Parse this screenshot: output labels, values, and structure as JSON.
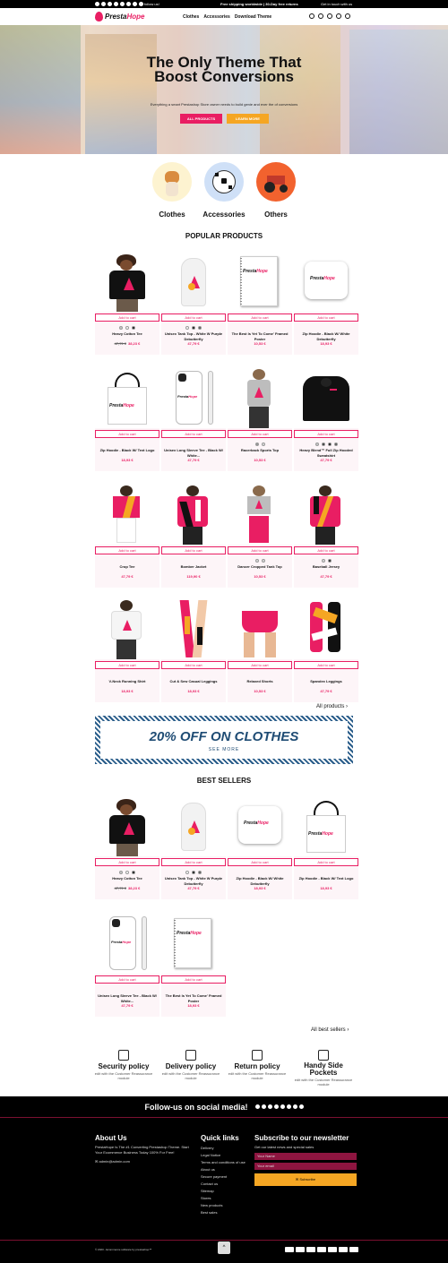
{
  "topbar": {
    "follow_label": "follow us!",
    "shipping": "Free shipping worldwide | 30-Day free returns",
    "touch": "Get in touch with us"
  },
  "header": {
    "logo_a": "Presta",
    "logo_b": "Hope",
    "nav": [
      "Clothes",
      "Accessories",
      "Download Theme"
    ]
  },
  "hero": {
    "title": "The Only Theme That Boost Conversions",
    "subtitle": "Everything a smart Prestashop Store owner needs to build genie and ever the of conversions",
    "btn_primary": "ALL PRODUCTS",
    "btn_secondary": "LEARN MORE"
  },
  "categories": [
    {
      "label": "Clothes",
      "icon": "dog-icon",
      "bg": "#fdf3d0"
    },
    {
      "label": "Accessories",
      "icon": "soccer-ball-icon",
      "bg": "#cfe0f7"
    },
    {
      "label": "Others",
      "icon": "tractor-icon",
      "bg": "#f2622e"
    }
  ],
  "popular": {
    "title": "POPULAR PRODUCTS",
    "add_to_cart": "Add to cart",
    "products": [
      {
        "name": "Heavy Cotton Tee",
        "price": "38,23 €",
        "old_price": "47,79 €",
        "img": "tshirt-woman"
      },
      {
        "name": "Unisex Tank Top - White W Purple Debutterfly",
        "price": "47,79 €",
        "img": "tank-white"
      },
      {
        "name": "The Best Is Yet To Come' Framed Poster",
        "price": "10,53 €",
        "img": "notebook"
      },
      {
        "name": "Zip Hoodie - Black W/ White Debutterfly",
        "price": "18,93 €",
        "img": "pillow"
      },
      {
        "name": "Zip Hoodie - Black W/ Text Logo",
        "price": "18,93 €",
        "img": "tote"
      },
      {
        "name": "Unisex Long Sleeve Tee - Black W/ White...",
        "price": "47,79 €",
        "img": "phonecase"
      },
      {
        "name": "Racerback Sports Top",
        "price": "10,53 €",
        "img": "sports-top"
      },
      {
        "name": "Heavy Blend™ Full Zip Hooded Sweatshirt",
        "price": "47,79 €",
        "img": "hoodie"
      },
      {
        "name": "Crop Tee",
        "price": "47,79 €",
        "img": "crop-tee"
      },
      {
        "name": "Bomber Jacket",
        "price": "119,90 €",
        "img": "bomber"
      },
      {
        "name": "Dancer Cropped Tank Top",
        "price": "10,53 €",
        "img": "dancer-tank"
      },
      {
        "name": "Baseball Jersey",
        "price": "47,79 €",
        "img": "jersey"
      },
      {
        "name": "V-Neck Running Shirt",
        "price": "18,93 €",
        "img": "vneck"
      },
      {
        "name": "Cut & Sew Casual Leggings",
        "price": "18,93 €",
        "img": "leggings"
      },
      {
        "name": "Relaxed Shorts",
        "price": "10,53 €",
        "img": "shorts"
      },
      {
        "name": "Spandex Leggings",
        "price": "47,79 €",
        "img": "spandex"
      }
    ],
    "all_link": "All products"
  },
  "banner": {
    "headline": "20% OFF ON CLOTHES",
    "cta": "SEE MORE"
  },
  "bestsellers": {
    "title": "BEST SELLERS",
    "add_to_cart": "Add to cart",
    "products": [
      {
        "name": "Heavy Cotton Tee",
        "price": "38,23 €",
        "old_price": "47,79 €",
        "img": "tshirt-woman"
      },
      {
        "name": "Unisex Tank Top - White W Purple Debutterfly",
        "price": "47,79 €",
        "img": "tank-white"
      },
      {
        "name": "Zip Hoodie - Black W/ White Debutterfly",
        "price": "18,93 €",
        "img": "pillow"
      },
      {
        "name": "Zip Hoodie - Black W/ Text Logo",
        "price": "18,93 €",
        "img": "tote"
      },
      {
        "name": "Unisex Long Sleeve Tee - Black W/ White...",
        "price": "47,79 €",
        "img": "phonecase"
      },
      {
        "name": "The Best Is Yet To Come' Framed Poster",
        "price": "18,93 €",
        "img": "notebook"
      }
    ],
    "all_link": "All best sellers"
  },
  "policies": [
    {
      "title": "Security policy",
      "desc": "edit with the Customer Reassurance module",
      "icon": "shield-icon"
    },
    {
      "title": "Delivery policy",
      "desc": "edit with the Customer Reassurance module",
      "icon": "truck-icon"
    },
    {
      "title": "Return policy",
      "desc": "edit with the Customer Reassurance module",
      "icon": "return-icon"
    },
    {
      "title": "Handy Side Pockets",
      "desc": "edit with the Customer Reassurance module",
      "icon": "pocket-icon"
    }
  ],
  "footer": {
    "follow": "Follow-us on social media!",
    "about_title": "About Us",
    "about_text": "PrestaHope Is The #1 Converting Prestashop Theme. Start Your Ecommerce Business Today 100% For Free!",
    "email": "admin@admin.com",
    "quick_title": "Quick links",
    "quick_links": [
      "Delivery",
      "Legal Notice",
      "Terms and conditions of use",
      "About us",
      "Secure payment",
      "Contact us",
      "Sitemap",
      "Stores",
      "New products",
      "Best sales"
    ],
    "news_title": "Subscribe to our newsletter",
    "news_sub": "Get our latest news and special sales",
    "name_placeholder": "Your Name",
    "email_placeholder": "Your email",
    "subscribe": "Subscribe",
    "copyright": "© 2023 - Ecommerce software by prestashop™"
  },
  "colors": {
    "accent": "#e91e63",
    "secondary": "#f5a623",
    "footer_bg": "#000000"
  }
}
